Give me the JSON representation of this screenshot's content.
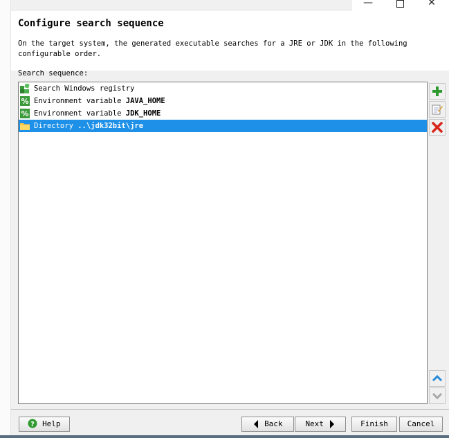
{
  "window": {
    "minimize_glyph": "—",
    "close_glyph": "✕"
  },
  "header": {
    "title": "Configure search sequence",
    "description": "On the target system, the generated executable searches for a JRE or JDK in the following configurable order."
  },
  "sequence": {
    "label": "Search sequence:",
    "items": [
      {
        "prefix": "Search Windows registry",
        "bold": "",
        "icon": "registry-icon"
      },
      {
        "prefix": "Environment variable ",
        "bold": "JAVA_HOME",
        "icon": "env-variable-icon"
      },
      {
        "prefix": "Environment variable ",
        "bold": "JDK_HOME",
        "icon": "env-variable-icon"
      },
      {
        "prefix": "Directory ",
        "bold": "..\\jdk32bit\\jre",
        "icon": "folder-icon",
        "selected": true
      }
    ]
  },
  "side_buttons": {
    "add": "plus-icon",
    "edit": "edit-icon",
    "remove": "delete-icon",
    "up": "arrow-up-icon",
    "down": "arrow-down-icon"
  },
  "buttons": {
    "help": "Help",
    "back": "Back",
    "next": "Next",
    "finish": "Finish",
    "cancel": "Cancel"
  },
  "colors": {
    "selection": "#1e90e8",
    "add_green": "#2e9a2e",
    "delete_red": "#d8261c",
    "arrow_blue": "#2a8ad8"
  }
}
